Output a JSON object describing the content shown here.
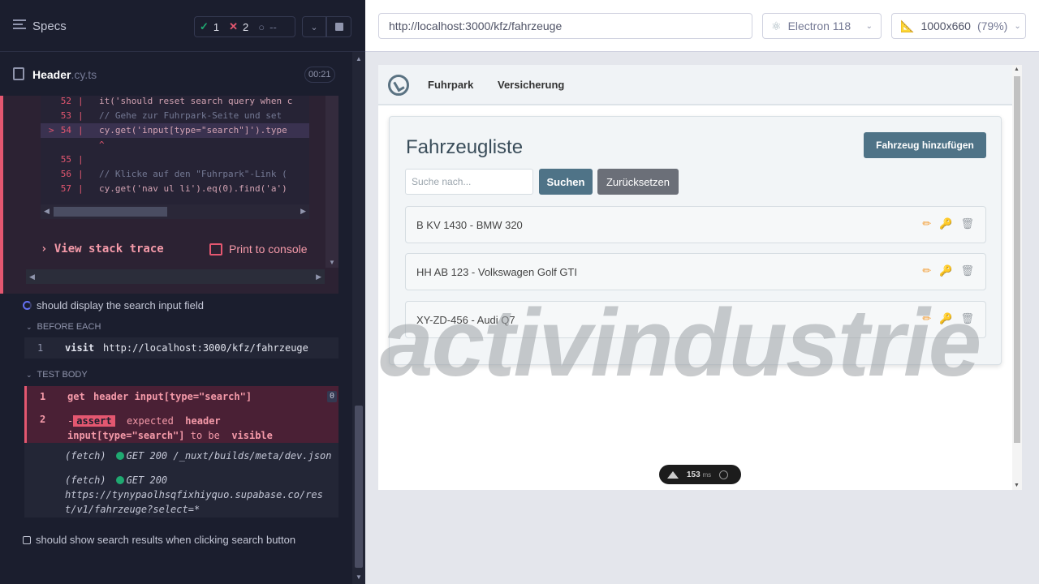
{
  "runner": {
    "specs_label": "Specs",
    "stats": {
      "passed": "1",
      "failed": "2",
      "pending": "--"
    },
    "file": {
      "name": "Header",
      "ext": ".cy.ts",
      "time": "00:21"
    }
  },
  "error": {
    "code_lines": [
      {
        "num": "52",
        "text": "it('should reset search query when c"
      },
      {
        "num": "53",
        "text": "  // Gehe zur Fuhrpark-Seite und set"
      },
      {
        "num": "54",
        "text": "  cy.get('input[type=\"search\"]').type"
      },
      {
        "num": "",
        "text": "     ^"
      },
      {
        "num": "55",
        "text": ""
      },
      {
        "num": "56",
        "text": "  // Klicke auf den \"Fuhrpark\"-Link ("
      },
      {
        "num": "57",
        "text": "  cy.get('nav ul li').eq(0).find('a')"
      }
    ],
    "current_marker": ">",
    "view_stack_trace": "View stack trace",
    "print_to_console": "Print to console"
  },
  "test1": {
    "title": "should display the search input field",
    "before_each_label": "BEFORE EACH",
    "before_each": {
      "num": "1",
      "name": "visit",
      "msg": "http://localhost:3000/kfz/fahrzeuge"
    },
    "test_body_label": "TEST BODY",
    "cmd1": {
      "num": "1",
      "name": "get",
      "msg": "header input[type=\"search\"]",
      "badge": "0"
    },
    "cmd2": {
      "num": "2",
      "prefix": "-",
      "tag": "assert",
      "pre": "expected",
      "sel": "header input[type=\"search\"]",
      "mid": "to be",
      "post": "visible"
    },
    "fetch1": {
      "type": "(fetch)",
      "req": "GET 200 /_nuxt/builds/meta/dev.json"
    },
    "fetch2": {
      "type": "(fetch)",
      "req": "GET 200",
      "url": "https://tynypaolhsqfixhiyquo.supabase.co/rest/v1/fahrzeuge?select=*"
    }
  },
  "test2": {
    "title": "should show search results when clicking search button"
  },
  "browser": {
    "url": "http://localhost:3000/kfz/fahrzeuge",
    "name": "Electron 118",
    "viewport": "1000x660",
    "zoom": "(79%)"
  },
  "app": {
    "nav": [
      "Fuhrpark",
      "Versicherung"
    ],
    "title": "Fahrzeugliste",
    "add_button": "Fahrzeug hinzufügen",
    "search_placeholder": "Suche nach...",
    "search_button": "Suchen",
    "reset_button": "Zurücksetzen",
    "vehicles": [
      "B KV 1430 - BMW 320",
      "HH AB 123 - Volkswagen Golf GTI",
      "XY-ZD-456 - Audi Q7"
    ],
    "watermark": "activindustrie",
    "perf_value": "153",
    "perf_unit": "ms"
  },
  "colors": {
    "pass": "#1fa971",
    "fail": "#e45770",
    "app_button": "#4f7387",
    "reset_button": "#6b6f78"
  }
}
